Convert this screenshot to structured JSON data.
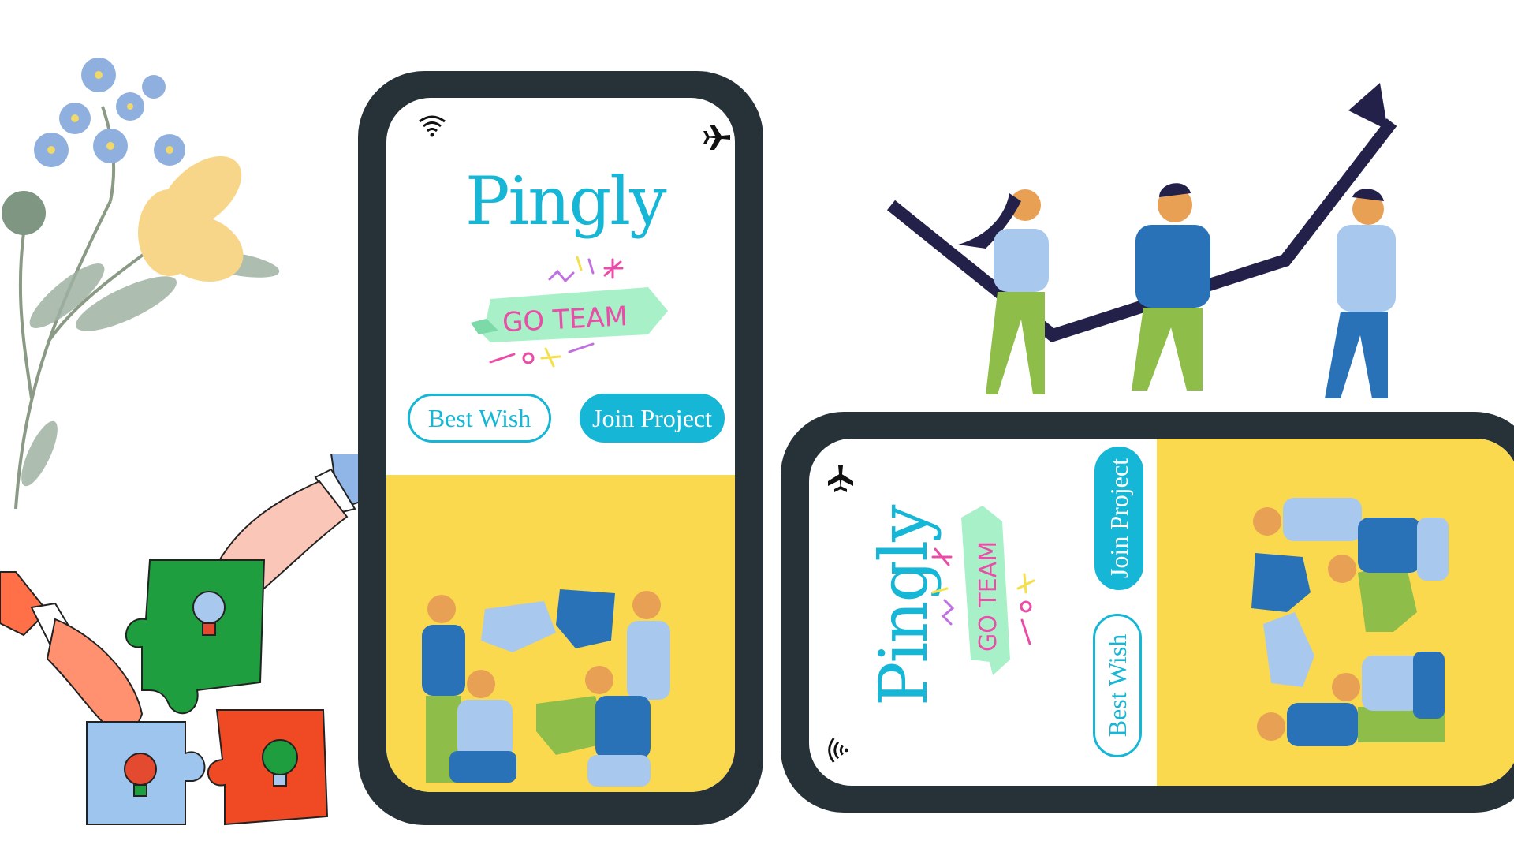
{
  "brand": {
    "name": "Pingly"
  },
  "badge": {
    "text": "GO TEAM"
  },
  "buttons": {
    "best_wish": "Best Wish",
    "join_project": "Join Project"
  },
  "colors": {
    "accent": "#16b7d6",
    "phone_frame": "#263238",
    "yellow_panel": "#fbd94e",
    "badge_ribbon": "#a8f0c8",
    "badge_text": "#ea4ca8"
  },
  "icons": {
    "status_left": "wifi-icon",
    "status_right": "airplane-icon",
    "illustrations": [
      "flower-illustration",
      "puzzle-hands-illustration",
      "team-growth-chart-illustration",
      "team-puzzle-illustration"
    ]
  }
}
